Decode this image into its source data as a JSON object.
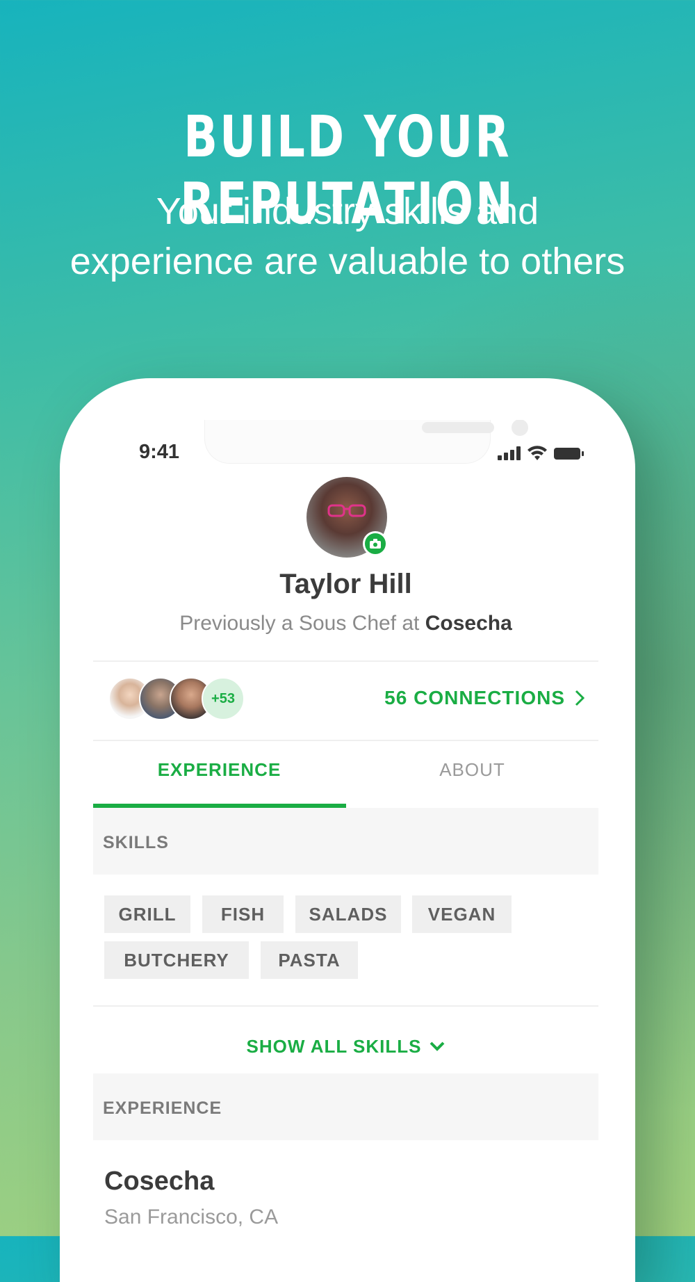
{
  "hero": {
    "headline": "BUILD YOUR REPUTATION",
    "subhead_line1": "Your industry skills and",
    "subhead_line2": "experience are valuable to others"
  },
  "status_bar": {
    "time": "9:41"
  },
  "profile": {
    "name": "Taylor Hill",
    "previously_prefix": "Previously a Sous Chef at ",
    "previously_company": "Cosecha"
  },
  "connections": {
    "more_count": "+53",
    "label": "56 CONNECTIONS"
  },
  "tabs": [
    {
      "label": "EXPERIENCE",
      "active": true
    },
    {
      "label": "ABOUT",
      "active": false
    }
  ],
  "skills": {
    "heading": "SKILLS",
    "items": [
      "GRILL",
      "FISH",
      "SALADS",
      "VEGAN",
      "BUTCHERY",
      "PASTA"
    ],
    "show_all": "SHOW ALL SKILLS"
  },
  "experience": {
    "heading": "EXPERIENCE",
    "company": "Cosecha",
    "location": "San Francisco, CA"
  },
  "colors": {
    "accent": "#1aad44",
    "text_dark": "#3b3b3b",
    "text_muted": "#8a8a8a"
  }
}
